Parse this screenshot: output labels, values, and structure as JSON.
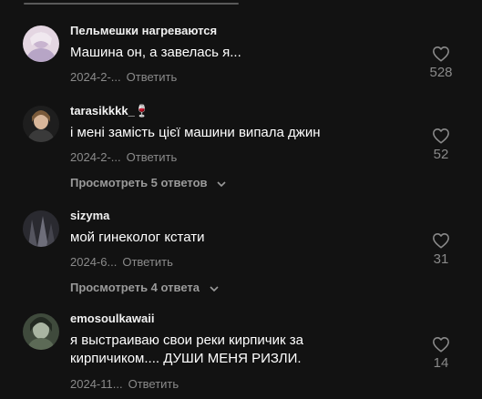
{
  "comments": [
    {
      "username": "Пельмешки нагреваются",
      "text": "Машина он, а завелась я...",
      "date": "2024-2-...",
      "reply_label": "Ответить",
      "likes": "528",
      "avatar_colors": [
        "#d9c8d8",
        "#b9a9c7"
      ]
    },
    {
      "username": "tarasikkkk_🍷",
      "text": "і мені замість цієї машини випала джин",
      "date": "2024-2-...",
      "reply_label": "Ответить",
      "likes": "52",
      "view_replies": "Просмотреть 5 ответов",
      "avatar_colors": [
        "#2b2b2b",
        "#c9a58a"
      ]
    },
    {
      "username": "sizyma",
      "text": "мой гинеколог кстати",
      "date": "2024-6...",
      "reply_label": "Ответить",
      "likes": "31",
      "view_replies": "Просмотреть 4 ответа",
      "avatar_colors": [
        "#3a3a44",
        "#6b6b78"
      ]
    },
    {
      "username": "emosoulkawaii",
      "text": "я выстраиваю свои реки кирпичик за кирпичиком.... ДУШИ МЕНЯ РИЗЛИ.",
      "date": "2024-11...",
      "reply_label": "Ответить",
      "likes": "14",
      "avatar_colors": [
        "#4d5a48",
        "#8fa08a"
      ]
    }
  ]
}
